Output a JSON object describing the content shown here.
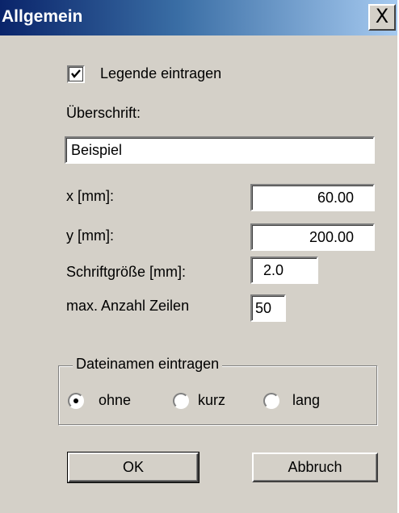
{
  "window": {
    "title": "Allgemein",
    "close_glyph": "X"
  },
  "legend_checkbox": {
    "label": "Legende eintragen",
    "checked": true
  },
  "heading_field": {
    "label": "Überschrift:",
    "value": "Beispiel"
  },
  "x_field": {
    "label": "x [mm]:",
    "value": "60.00"
  },
  "y_field": {
    "label": "y [mm]:",
    "value": "200.00"
  },
  "font_size_field": {
    "label": "Schriftgröße [mm]:",
    "value": "2.0"
  },
  "max_lines_field": {
    "label": "max. Anzahl Zeilen",
    "value": "50"
  },
  "filename_group": {
    "title": "Dateinamen eintragen",
    "options": [
      {
        "label": "ohne",
        "selected": true
      },
      {
        "label": "kurz",
        "selected": false
      },
      {
        "label": "lang",
        "selected": false
      }
    ]
  },
  "buttons": {
    "ok": "OK",
    "cancel": "Abbruch"
  },
  "colors": {
    "dialog_bg": "#d4d0c8",
    "title_bar": "#0a246a"
  }
}
